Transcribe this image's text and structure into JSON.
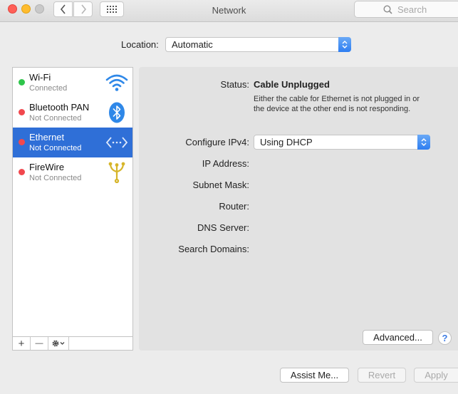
{
  "window": {
    "title": "Network"
  },
  "toolbar": {
    "back_icon": "chevron-left-icon",
    "forward_icon": "chevron-right-icon",
    "grid_icon": "grid-icon",
    "search_placeholder": "Search"
  },
  "location": {
    "label": "Location:",
    "value": "Automatic"
  },
  "services": [
    {
      "name": "Wi-Fi",
      "status": "Connected",
      "dot_color": "#2ec54b",
      "icon": "wifi-icon",
      "selected": false
    },
    {
      "name": "Bluetooth PAN",
      "status": "Not Connected",
      "dot_color": "#f1484e",
      "icon": "bluetooth-icon",
      "selected": false
    },
    {
      "name": "Ethernet",
      "status": "Not Connected",
      "dot_color": "#f1484e",
      "icon": "ethernet-icon",
      "selected": true
    },
    {
      "name": "FireWire",
      "status": "Not Connected",
      "dot_color": "#f1484e",
      "icon": "firewire-icon",
      "selected": false
    }
  ],
  "sidebar_tools": {
    "add": "+",
    "remove": "—",
    "gear_icon": "gear-icon"
  },
  "detail": {
    "status_label": "Status:",
    "status_value": "Cable Unplugged",
    "status_description": "Either the cable for Ethernet is not plugged in or the device at the other end is not responding.",
    "configure_label": "Configure IPv4:",
    "configure_value": "Using DHCP",
    "fields": {
      "ip_address": "IP Address:",
      "subnet_mask": "Subnet Mask:",
      "router": "Router:",
      "dns_server": "DNS Server:",
      "search_domains": "Search Domains:"
    },
    "advanced_label": "Advanced...",
    "help_label": "?"
  },
  "footer": {
    "assist_label": "Assist Me...",
    "revert_label": "Revert",
    "apply_label": "Apply"
  },
  "colors": {
    "selection": "#2f6fd7",
    "accent": "#2e7ef1"
  }
}
